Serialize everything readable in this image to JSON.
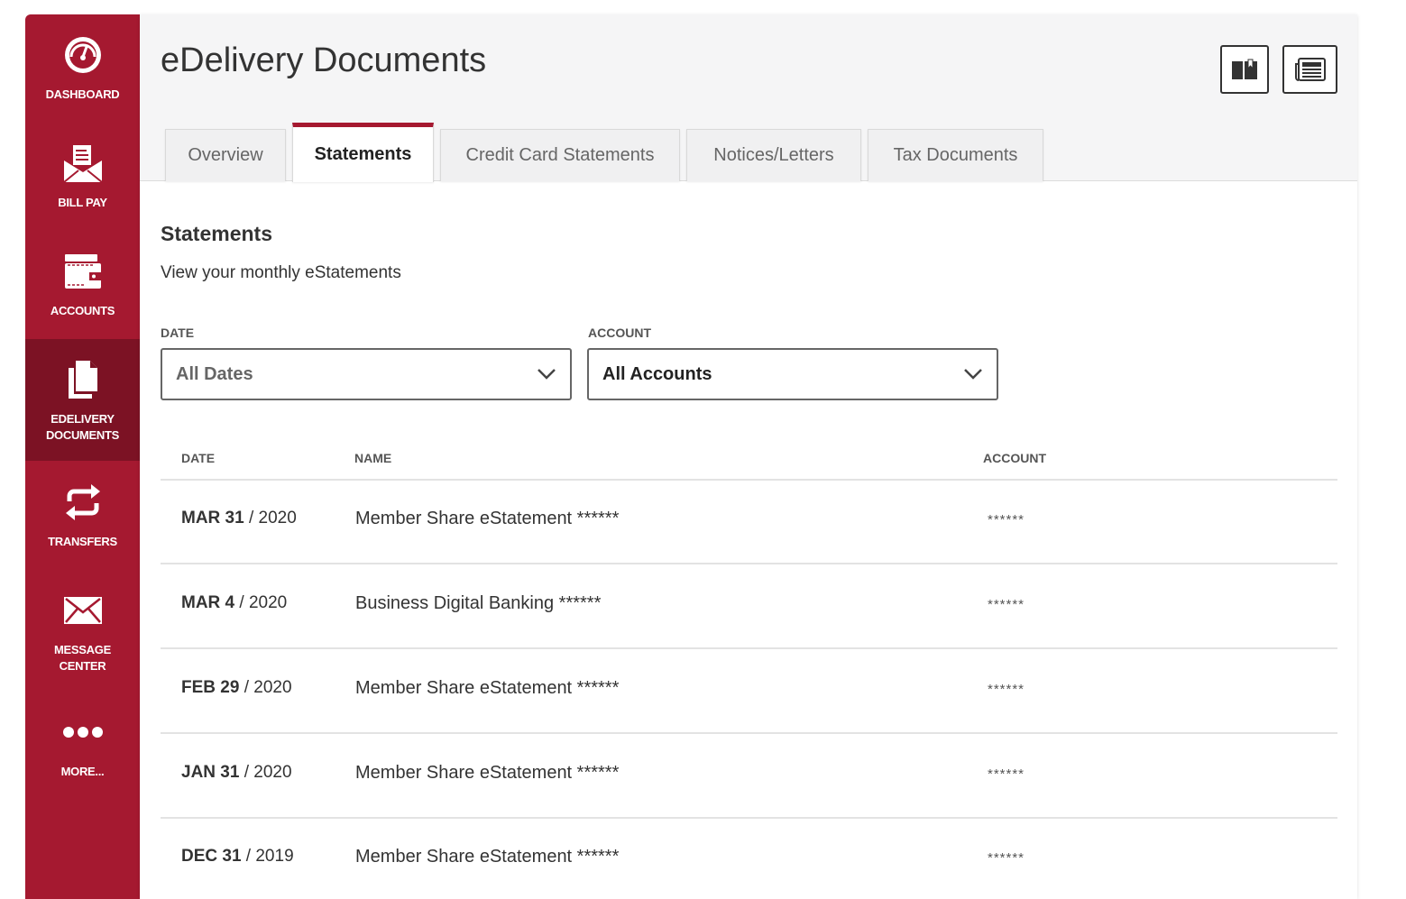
{
  "sidebar": {
    "items": [
      {
        "label": "DASHBOARD",
        "icon": "dashboard-icon"
      },
      {
        "label": "BILL PAY",
        "icon": "bill-pay-icon"
      },
      {
        "label": "ACCOUNTS",
        "icon": "accounts-icon"
      },
      {
        "label": "EDELIVERY\nDOCUMENTS",
        "icon": "documents-icon",
        "active": true
      },
      {
        "label": "TRANSFERS",
        "icon": "transfers-icon"
      },
      {
        "label": "MESSAGE\nCENTER",
        "icon": "envelope-icon"
      },
      {
        "label": "MORE...",
        "icon": "more-icon"
      }
    ]
  },
  "header": {
    "title": "eDelivery Documents",
    "buttons": [
      "book-icon",
      "newspaper-icon"
    ]
  },
  "tabs": [
    {
      "label": "Overview"
    },
    {
      "label": "Statements",
      "active": true
    },
    {
      "label": "Credit Card Statements"
    },
    {
      "label": "Notices/Letters"
    },
    {
      "label": "Tax Documents"
    }
  ],
  "section": {
    "title": "Statements",
    "subtitle": "View your monthly eStatements"
  },
  "filters": {
    "date": {
      "label": "DATE",
      "value": "All Dates"
    },
    "account": {
      "label": "ACCOUNT",
      "value": "All Accounts"
    }
  },
  "table": {
    "headers": {
      "date": "DATE",
      "name": "NAME",
      "account": "ACCOUNT"
    },
    "rows": [
      {
        "date_main": "MAR 31",
        "date_year": " / 2020",
        "name": "Member Share eStatement ******",
        "account": "******"
      },
      {
        "date_main": "MAR 4",
        "date_year": " / 2020",
        "name": "Business Digital Banking ******",
        "account": "******"
      },
      {
        "date_main": "FEB 29",
        "date_year": " / 2020",
        "name": "Member Share eStatement ******",
        "account": "******"
      },
      {
        "date_main": "JAN 31",
        "date_year": " / 2020",
        "name": "Member Share eStatement ******",
        "account": "******"
      },
      {
        "date_main": "DEC 31",
        "date_year": " / 2019",
        "name": "Member Share eStatement ******",
        "account": "******"
      }
    ]
  },
  "colors": {
    "brand": "#a51930",
    "brand_active": "#7c1224"
  }
}
